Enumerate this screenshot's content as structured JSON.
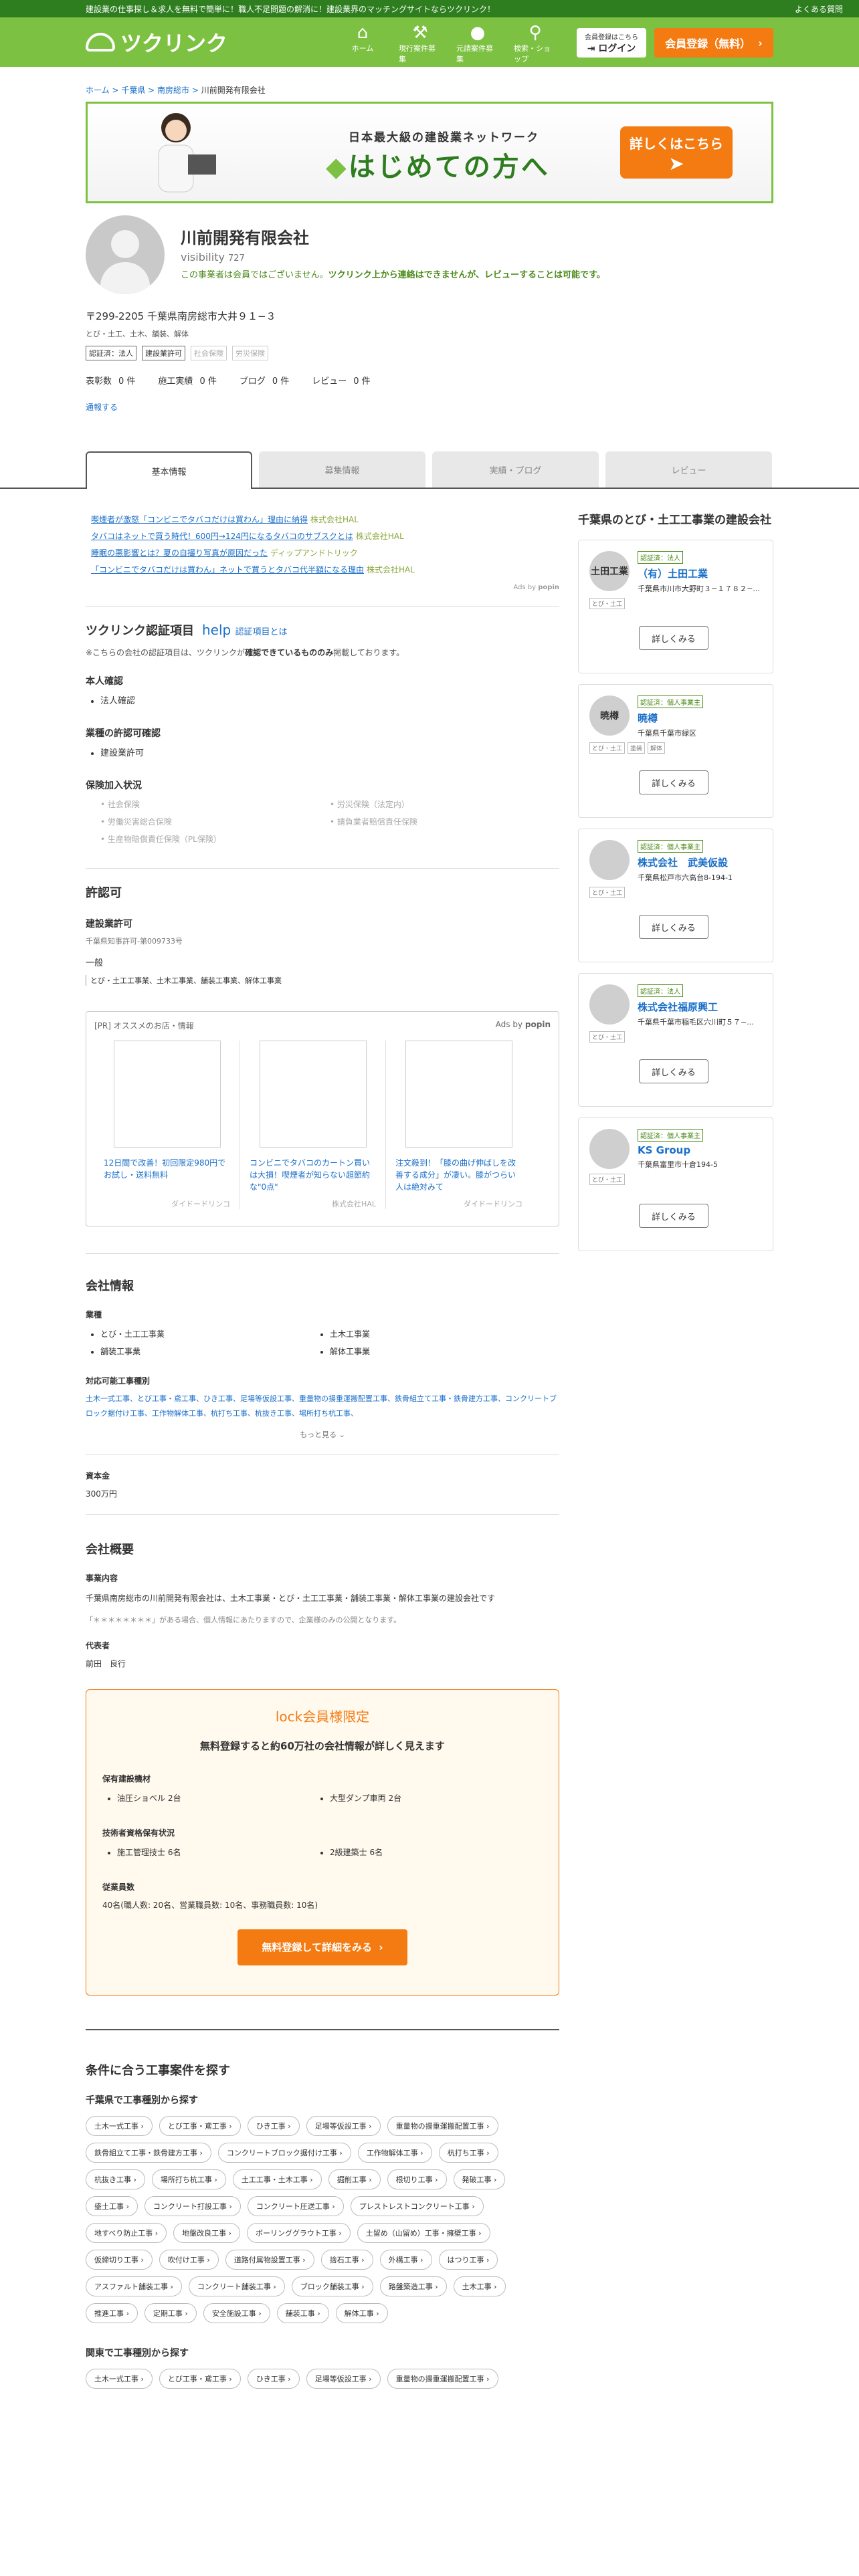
{
  "topbar": {
    "tagline": "建設業の仕事探し＆求人を無料で簡単に！職人不足問題の解消に！建設業界のマッチングサイトならツクリンク！",
    "faq": "よくある質問"
  },
  "header": {
    "logo_text": "ツクリンク",
    "nav": [
      {
        "label": "ホーム",
        "icon": "home-icon"
      },
      {
        "label": "現行案件募集",
        "icon": "hammer-icon"
      },
      {
        "label": "元請案件募集",
        "icon": "worker-icon"
      },
      {
        "label": "検索・ショップ",
        "icon": "search-icon"
      }
    ],
    "login_small": "会員登録はこちら",
    "login": "ログイン",
    "signup": "会員登録（無料）"
  },
  "breadcrumb": [
    "ホーム",
    "千葉県",
    "南房総市",
    "川前開発有限会社"
  ],
  "banner": {
    "sub": "日本最大級の建設業ネットワーク",
    "title": "はじめての方へ",
    "cta": "詳しくはこちら"
  },
  "company": {
    "name": "川前開発有限会社",
    "visibility_label": "visibility",
    "visibility_count": "727",
    "notice_a": "この事業者は会員ではございません。",
    "notice_b": "ツクリンク上から連絡はできませんが、レビューすることは可能です。",
    "address": "〒299-2205 千葉県南房総市大井９１−３",
    "trades": "とび・土工、土木、舗装、解体",
    "badges": [
      "認証済：法人",
      "建設業許可",
      "社会保険",
      "労災保険"
    ],
    "stats": [
      {
        "label": "表彰数",
        "value": "0 件"
      },
      {
        "label": "施工実績",
        "value": "0 件"
      },
      {
        "label": "ブログ",
        "value": "0 件"
      },
      {
        "label": "レビュー",
        "value": "0 件"
      }
    ],
    "report": "通報する"
  },
  "tabs": [
    "基本情報",
    "募集情報",
    "実績・ブログ",
    "レビュー"
  ],
  "ads": [
    {
      "text": "喫煙者が激怒「コンビニでタバコだけは買わん」理由に納得",
      "src": "株式会社HAL"
    },
    {
      "text": "タバコはネットで買う時代！600円→124円になるタバコのサブスクとは",
      "src": "株式会社HAL"
    },
    {
      "text": "睡眠の悪影響とは？夏の自撮り写真が原因だった",
      "src": "ディップアンドトリック"
    },
    {
      "text": "「コンビニでタバコだけは買わん」ネットで買うとタバコ代半額になる理由",
      "src": "株式会社HAL"
    }
  ],
  "ads_by": "Ads by",
  "ads_popin": "popin",
  "cert": {
    "title": "ツクリンク認証項目",
    "help": "help",
    "help_text": "認証項目とは",
    "note_a": "※こちらの会社の認証項目は、ツクリンクが",
    "note_b": "確認できているもののみ",
    "note_c": "掲載しております。",
    "identity_title": "本人確認",
    "identity": "法人確認",
    "permit_title": "業種の許認可確認",
    "permit": "建設業許可",
    "insurance_title": "保険加入状況",
    "insurance": [
      "社会保険",
      "労災保険（法定内）",
      "労働災害総合保険",
      "請負業者賠償責任保険",
      "生産物賠償責任保険（PL保険）"
    ]
  },
  "license": {
    "title": "許認可",
    "sub": "建設業許可",
    "number": "千葉県知事許可-第009733号",
    "type": "一般",
    "trades": "とび・土工工事業、土木工事業、舗装工事業、解体工事業"
  },
  "pr": {
    "label": "[PR] オススメのお店・情報",
    "cards": [
      {
        "text": "12日間で改善！初回限定980円でお試し・送料無料",
        "src": "ダイドードリンコ"
      },
      {
        "text": "コンビニでタバコのカートン買いは大損！喫煙者が知らない超節約な\"0点\"",
        "src": "株式会社HAL"
      },
      {
        "text": "注文殺到！「膝の曲げ伸ばしを改善する成分」が凄い。膝がつらい人は絶対みて",
        "src": "ダイドードリンコ"
      }
    ]
  },
  "company_info": {
    "title": "会社情報",
    "industry_title": "業種",
    "industries": [
      "とび・土工工事業",
      "土木工事業",
      "舗装工事業",
      "解体工事業"
    ],
    "trade_types_title": "対応可能工事種別",
    "trade_types": "土木一式工事、とび工事・鳶工事、ひき工事、足場等仮設工事、重量物の揚重運搬配置工事、鉄骨組立て工事・鉄骨建方工事、コンクリートブロック据付け工事、工作物解体工事、杭打ち工事、杭抜き工事、場所打ち杭工事、",
    "more": "もっと見る",
    "capital_title": "資本金",
    "capital": "300万円"
  },
  "overview": {
    "title": "会社概要",
    "business_title": "事業内容",
    "business": "千葉県南房総市の川前開発有限会社は、土木工事業・とび・土工工事業・舗装工事業・解体工事業の建設会社です",
    "note": "「＊＊＊＊＊＊＊＊」がある場合、個人情報にあたりますので、企業様のみの公開となります。",
    "rep_title": "代表者",
    "rep": "前田　良行"
  },
  "members": {
    "lock": "lock",
    "title": "会員様限定",
    "lead": "無料登録すると約60万社の会社情報が詳しく見えます",
    "equip_title": "保有建設機材",
    "equip": [
      "油圧ショベル 2台",
      "大型ダンプ車両 2台"
    ],
    "qual_title": "技術者資格保有状況",
    "qual": [
      "施工管理技士 6名",
      "2級建築士 6名"
    ],
    "staff_title": "従業員数",
    "staff": "40名(職人数: 20名、営業職員数: 10名、事務職員数: 10名)",
    "cta": "無料登録して詳細をみる"
  },
  "search": {
    "title": "条件に合う工事案件を探す",
    "sub1": "千葉県で工事種別から探す",
    "chips1": [
      "土木一式工事",
      "とび工事・鳶工事",
      "ひき工事",
      "足場等仮設工事",
      "重量物の揚重運搬配置工事",
      "鉄骨組立て工事・鉄骨建方工事",
      "コンクリートブロック据付け工事",
      "工作物解体工事",
      "杭打ち工事",
      "杭抜き工事",
      "場所打ち杭工事",
      "土工工事・土木工事",
      "掘削工事",
      "根切り工事",
      "発破工事",
      "盛土工事",
      "コンクリート打設工事",
      "コンクリート圧送工事",
      "プレストレストコンクリート工事",
      "地すべり防止工事",
      "地盤改良工事",
      "ボーリンググラウト工事",
      "土留め（山留め）工事・擁壁工事",
      "仮締切り工事",
      "吹付け工事",
      "道路付属物設置工事",
      "捨石工事",
      "外構工事",
      "はつり工事",
      "アスファルト舗装工事",
      "コンクリート舗装工事",
      "ブロック舗装工事",
      "路盤築造工事",
      "土木工事",
      "推進工事",
      "定期工事",
      "安全施設工事",
      "舗装工事",
      "解体工事"
    ],
    "sub2": "関東で工事種別から探す",
    "chips2": [
      "土木一式工事",
      "とび工事・鳶工事",
      "ひき工事",
      "足場等仮設工事",
      "重量物の揚重運搬配置工事"
    ]
  },
  "sidebar": {
    "title": "千葉県のとび・土工工事業の建設会社",
    "more": "詳しくみる",
    "cards": [
      {
        "logo": "土田工業",
        "tag": "認証済：法人",
        "name": "（有）土田工業",
        "addr": "千葉県市川市大野町３−１７８２−...",
        "trades": [
          "とび・土工"
        ]
      },
      {
        "logo": "暁樽",
        "tag": "認証済：個人事業主",
        "name": "暁樽",
        "addr": "千葉県千葉市緑区",
        "trades": [
          "とび・土工",
          "塗装",
          "解体"
        ]
      },
      {
        "logo": "",
        "tag": "認証済：個人事業主",
        "name": "株式会社　武美仮設",
        "addr": "千葉県松戸市六高台8-194-1",
        "trades": [
          "とび・土工"
        ]
      },
      {
        "logo": "",
        "tag": "認証済：法人",
        "name": "株式会社福原興工",
        "addr": "千葉県千葉市稲毛区穴川町５７−...",
        "trades": [
          "とび・土工"
        ]
      },
      {
        "logo": "",
        "tag": "認証済：個人事業主",
        "name": "KS Group",
        "addr": "千葉県富里市十倉194-5",
        "trades": [
          "とび・土工"
        ]
      }
    ]
  }
}
